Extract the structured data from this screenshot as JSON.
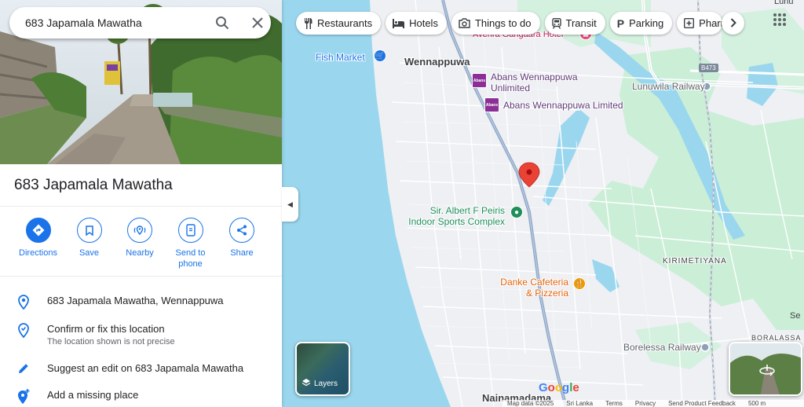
{
  "search": {
    "value": "683 Japamala Mawatha"
  },
  "place": {
    "title": "683 Japamala Mawatha"
  },
  "actions": [
    {
      "label": "Directions"
    },
    {
      "label": "Save"
    },
    {
      "label": "Nearby"
    },
    {
      "label": "Send to phone"
    },
    {
      "label": "Share"
    }
  ],
  "details": {
    "address": "683 Japamala Mawatha, Wennappuwa",
    "confirm": {
      "title": "Confirm or fix this location",
      "subtitle": "The location shown is not precise"
    },
    "suggest": "Suggest an edit on 683 Japamala Mawatha",
    "add_place": "Add a missing place"
  },
  "chips": [
    {
      "label": "Restaurants",
      "icon": "fork-knife-icon"
    },
    {
      "label": "Hotels",
      "icon": "bed-icon"
    },
    {
      "label": "Things to do",
      "icon": "camera-icon"
    },
    {
      "label": "Transit",
      "icon": "train-icon"
    },
    {
      "label": "Parking",
      "icon": "parking-icon"
    },
    {
      "label": "Pharm",
      "icon": "pharmacy-icon"
    }
  ],
  "map_labels": {
    "fish_market": "Fish Market",
    "wennappuwa": "Wennappuwa",
    "hotel": "Avenra Gangaara Hotel",
    "abans_unlimited": "Abans Wennappuwa Unlimited",
    "abans_limited": "Abans Wennappuwa Limited",
    "lunuwila_railway": "Lunuwila Railway",
    "road_badge": "B473",
    "sports_complex": "Sir. Albert F Peiris Indoor Sports Complex",
    "danke": "Danke Cafeteria & Pizzeria",
    "kirimetiyana": "KIRIMETIYANA",
    "borelessa_railway": "Borelessa Railway",
    "boralassa": "BORALASSA",
    "nainamadama": "Nainamadama",
    "top_right": "Lunu",
    "right_edge": "Se",
    "abans_badge": "Abans"
  },
  "layers_label": "Layers",
  "google": "Google",
  "footer": [
    "Map data ©2025",
    "Sri Lanka",
    "Terms",
    "Privacy",
    "Send Product Feedback",
    "500 m"
  ],
  "colors": {
    "accent": "#1a73e8",
    "water": "#9ad7ee",
    "park": "#cbeed7",
    "pin": "#ea4335",
    "rail": "#8ea0b8"
  }
}
